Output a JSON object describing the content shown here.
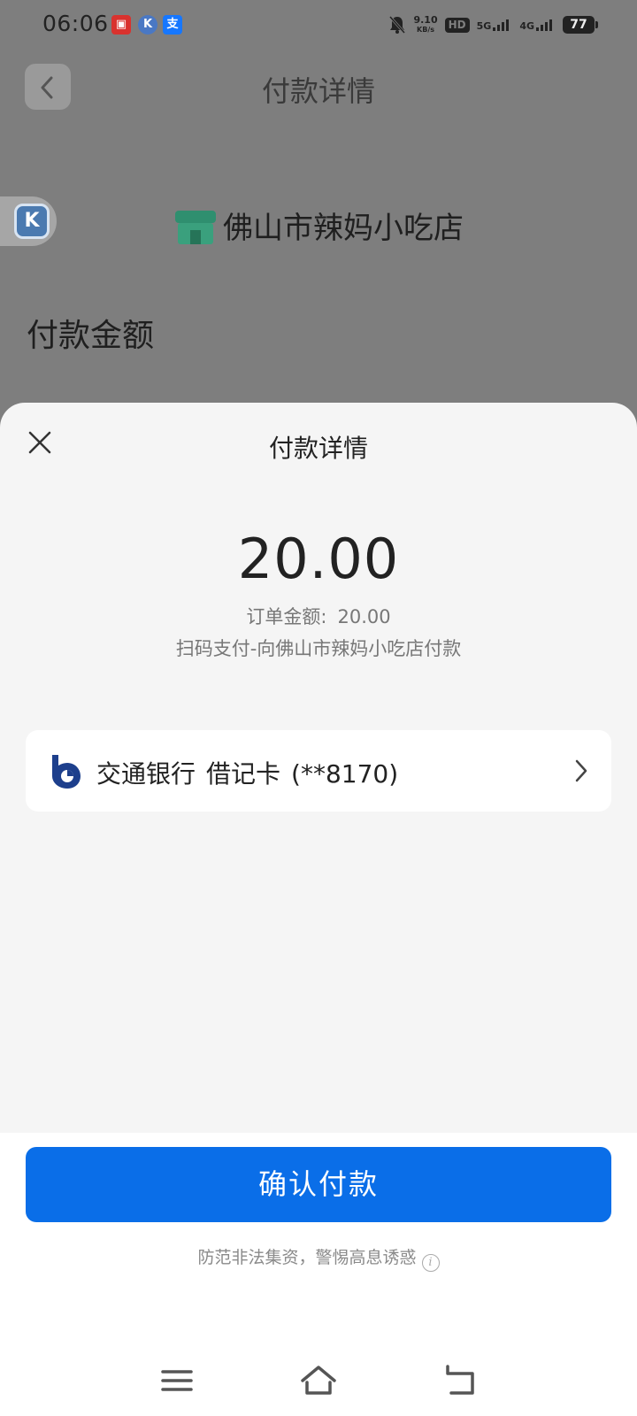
{
  "status_bar": {
    "time": "06:06",
    "network_speed_value": "9.10",
    "network_speed_unit": "KB/s",
    "hd_label": "HD",
    "signal_1": "5G",
    "signal_2": "4G",
    "battery": "77"
  },
  "background_page": {
    "title": "付款详情",
    "shop_name": "佛山市辣妈小吃店",
    "amount_label": "付款金额"
  },
  "sheet": {
    "title": "付款详情",
    "amount": "20.00",
    "order_label": "订单金额:",
    "order_value": "20.00",
    "description": "扫码支付-向佛山市辣妈小吃店付款",
    "payment_method": {
      "bank": "交通银行",
      "card_type": "借记卡",
      "card_number": "(**8170)"
    },
    "confirm_button": "确认付款",
    "notice": "防范非法集资，警惕高息诱惑"
  },
  "icons": {
    "close": "close-icon",
    "back": "back-chevron-icon",
    "bank": "bocom-logo-icon",
    "chevron": "chevron-right-icon",
    "info": "info-icon",
    "nav_menu": "menu-icon",
    "nav_home": "home-icon",
    "nav_back": "back-icon"
  },
  "colors": {
    "primary_button": "#0a6ee8",
    "bank_logo": "#1d3f8c",
    "shop_icon": "#2f8f6f"
  }
}
